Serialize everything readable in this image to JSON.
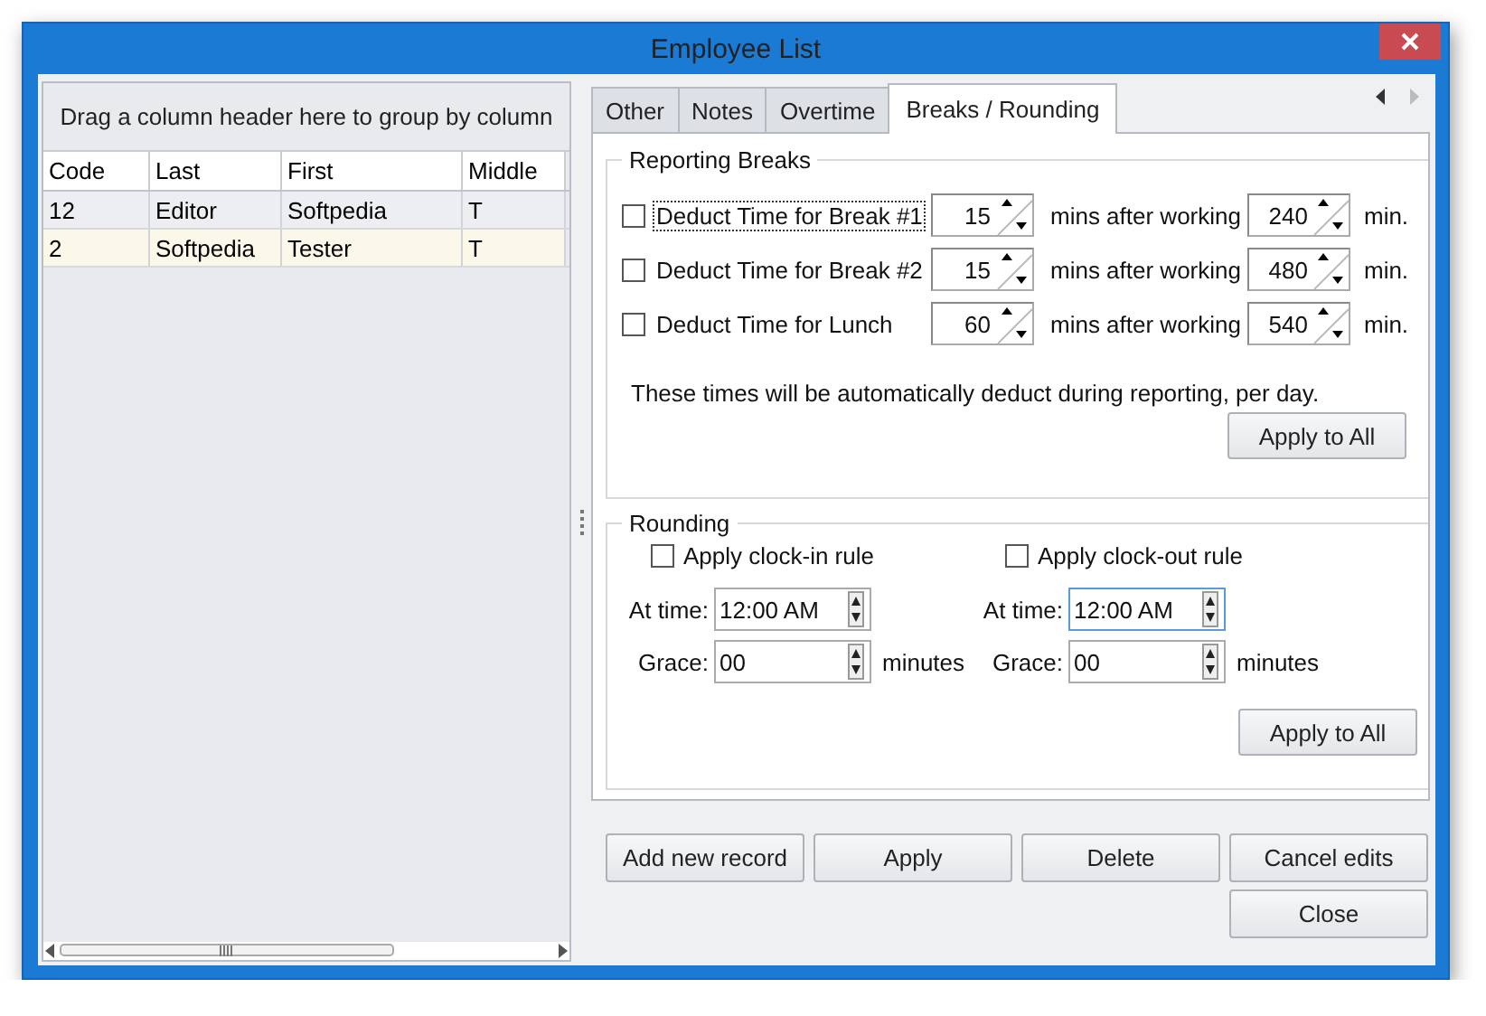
{
  "window": {
    "title": "Employee List"
  },
  "grid": {
    "group_hint": "Drag a column header here to group by column",
    "columns": [
      "Code",
      "Last",
      "First",
      "Middle"
    ],
    "rows": [
      {
        "cells": [
          "12",
          "Editor",
          "Softpedia",
          "T"
        ],
        "selected": false
      },
      {
        "cells": [
          "2",
          "Softpedia",
          "Tester",
          "T"
        ],
        "selected": true
      }
    ]
  },
  "tabs": [
    {
      "label": "Other",
      "selected": false
    },
    {
      "label": "Notes",
      "selected": false
    },
    {
      "label": "Overtime",
      "selected": false
    },
    {
      "label": "Breaks / Rounding",
      "selected": true
    }
  ],
  "reporting_breaks": {
    "title": "Reporting Breaks",
    "rows": [
      {
        "label": "Deduct Time for Break #1",
        "checked": false,
        "focused": true,
        "duration": "15",
        "after_label": "mins after working",
        "after": "240",
        "unit": "min."
      },
      {
        "label": "Deduct Time for Break #2",
        "checked": false,
        "focused": false,
        "duration": "15",
        "after_label": "mins after working",
        "after": "480",
        "unit": "min."
      },
      {
        "label": "Deduct Time for Lunch",
        "checked": false,
        "focused": false,
        "duration": "60",
        "after_label": "mins after working",
        "after": "540",
        "unit": "min."
      }
    ],
    "note": "These times will be automatically deduct during reporting, per day.",
    "apply_button": "Apply to All"
  },
  "rounding": {
    "title": "Rounding",
    "rules": [
      {
        "label": "Apply clock-in rule",
        "checked": false,
        "time_label": "At time:",
        "time": "12:00 AM",
        "time_focused": false,
        "grace_label": "Grace:",
        "grace": "00",
        "grace_unit": "minutes"
      },
      {
        "label": "Apply clock-out rule",
        "checked": false,
        "time_label": "At time:",
        "time": "12:00 AM",
        "time_focused": true,
        "grace_label": "Grace:",
        "grace": "00",
        "grace_unit": "minutes"
      }
    ],
    "apply_button": "Apply to All"
  },
  "buttons": [
    [
      "Add new record",
      "Apply",
      "Delete",
      "Cancel edits"
    ],
    [
      "Close"
    ]
  ]
}
